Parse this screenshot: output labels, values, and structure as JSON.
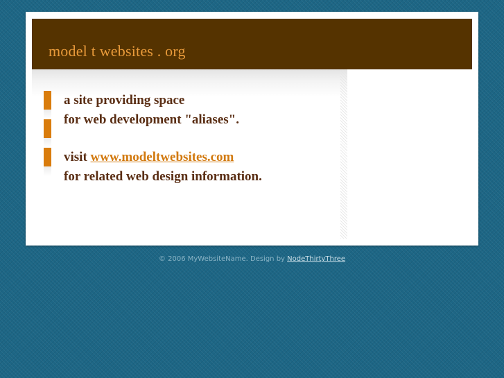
{
  "header": {
    "title": "model t websites . org"
  },
  "content": {
    "line1": "a site providing space",
    "line2": "for web development \"aliases\".",
    "visit_label": "visit ",
    "visit_link": "www.modeltwebsites.com ",
    "line4": "for related web design information."
  },
  "footer": {
    "copyright": "© 2006 MyWebsiteName. Design by ",
    "designer_link": "NodeThirtyThree"
  },
  "colors": {
    "background": "#1d6685",
    "header": "#553300",
    "title": "#e89a3a",
    "accent_bar": "#d97c0c",
    "text": "#5a2e14",
    "link": "#d27a10"
  }
}
